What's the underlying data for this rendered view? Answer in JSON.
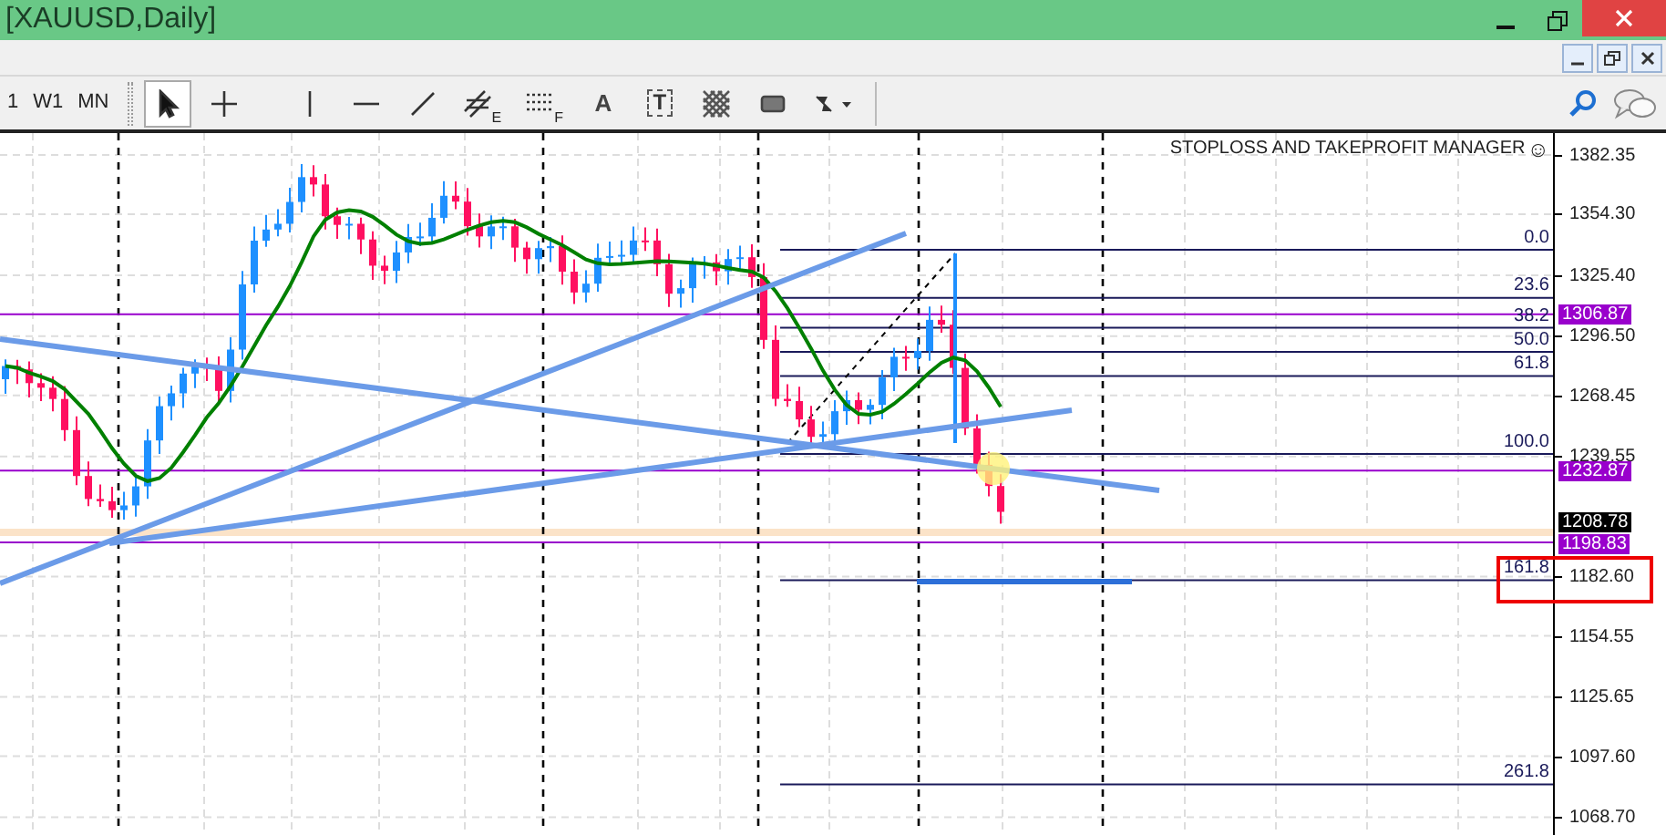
{
  "window": {
    "title": "[XAUUSD,Daily]"
  },
  "timeframes": [
    {
      "label": "1",
      "selected": false
    },
    {
      "label": "W1",
      "selected": false
    },
    {
      "label": "MN",
      "selected": false
    }
  ],
  "tools": [
    {
      "kind": "cursor",
      "selected": true
    },
    {
      "kind": "crosshair",
      "selected": false
    },
    {
      "kind": "vline",
      "selected": false
    },
    {
      "kind": "hline",
      "selected": false
    },
    {
      "kind": "trendline",
      "selected": false
    },
    {
      "kind": "fan",
      "label": "E",
      "selected": false
    },
    {
      "kind": "fibo",
      "label": "F",
      "selected": false
    },
    {
      "kind": "text",
      "label": "A",
      "selected": false
    },
    {
      "kind": "textlabel",
      "label": "T",
      "selected": false
    },
    {
      "kind": "pattern",
      "selected": false
    },
    {
      "kind": "rectangle",
      "selected": false
    },
    {
      "kind": "arrows",
      "selected": false
    }
  ],
  "chart": {
    "indicator_title": "STOPLOSS AND TAKEPROFIT MANAGER",
    "indicator_symbol": "☺",
    "price_axis": [
      "1382.35",
      "1354.30",
      "1325.40",
      "1296.50",
      "1268.45",
      "1239.55",
      "1182.60",
      "1154.55",
      "1125.65",
      "1097.60",
      "1068.70"
    ],
    "fib_levels": [
      "0.0",
      "23.6",
      "38.2",
      "50.0",
      "61.8",
      "100.0",
      "161.8",
      "261.8"
    ],
    "price_tags": [
      {
        "label": "1306.87",
        "color": "#9900cc"
      },
      {
        "label": "1232.87",
        "color": "#9900cc"
      },
      {
        "label": "1208.78",
        "color": "#000000"
      },
      {
        "label": "1198.83",
        "color": "#9900cc"
      }
    ]
  }
}
